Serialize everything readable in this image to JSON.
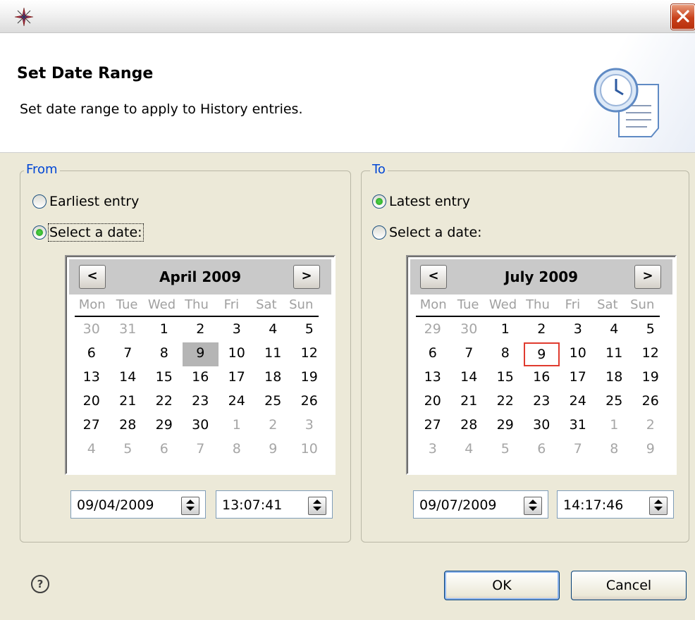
{
  "window": {
    "title": "",
    "close_icon": "close-icon",
    "app_icon": "compass-star-icon"
  },
  "header": {
    "title": "Set Date Range",
    "description": "Set date range to apply to History entries.",
    "banner_icon": "clock-document-icon"
  },
  "from": {
    "legend": "From",
    "options": [
      {
        "label": "Earliest entry",
        "checked": false
      },
      {
        "label": "Select a date:",
        "checked": true
      }
    ],
    "calendar": {
      "prev_label": "<",
      "next_label": ">",
      "month_label": "April 2009",
      "weekdays": [
        "Mon",
        "Tue",
        "Wed",
        "Thu",
        "Fri",
        "Sat",
        "Sun"
      ],
      "weeks": [
        [
          "30",
          "31",
          "1",
          "2",
          "3",
          "4",
          "5"
        ],
        [
          "6",
          "7",
          "8",
          "9",
          "10",
          "11",
          "12"
        ],
        [
          "13",
          "14",
          "15",
          "16",
          "17",
          "18",
          "19"
        ],
        [
          "20",
          "21",
          "22",
          "23",
          "24",
          "25",
          "26"
        ],
        [
          "27",
          "28",
          "29",
          "30",
          "1",
          "2",
          "3"
        ],
        [
          "4",
          "5",
          "6",
          "7",
          "8",
          "9",
          "10"
        ]
      ]
    },
    "date_value": "09/04/2009",
    "time_value": "13:07:41"
  },
  "to": {
    "legend": "To",
    "options": [
      {
        "label": "Latest entry",
        "checked": true
      },
      {
        "label": "Select a date:",
        "checked": false
      }
    ],
    "calendar": {
      "prev_label": "<",
      "next_label": ">",
      "month_label": "July 2009",
      "weekdays": [
        "Mon",
        "Tue",
        "Wed",
        "Thu",
        "Fri",
        "Sat",
        "Sun"
      ],
      "weeks": [
        [
          "29",
          "30",
          "1",
          "2",
          "3",
          "4",
          "5"
        ],
        [
          "6",
          "7",
          "8",
          "9",
          "10",
          "11",
          "12"
        ],
        [
          "13",
          "14",
          "15",
          "16",
          "17",
          "18",
          "19"
        ],
        [
          "20",
          "21",
          "22",
          "23",
          "24",
          "25",
          "26"
        ],
        [
          "27",
          "28",
          "29",
          "30",
          "31",
          "1",
          "2"
        ],
        [
          "3",
          "4",
          "5",
          "6",
          "7",
          "8",
          "9"
        ]
      ]
    },
    "date_value": "09/07/2009",
    "time_value": "14:17:46"
  },
  "footer": {
    "help_label": "?",
    "ok_label": "OK",
    "cancel_label": "Cancel"
  },
  "colors": {
    "accent": "#0046d5",
    "today_border": "#e03b2f",
    "selection": "#b5b5b5"
  }
}
